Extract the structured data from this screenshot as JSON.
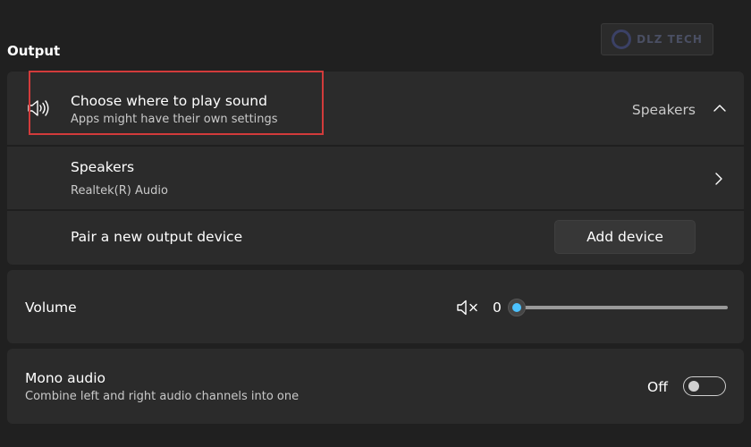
{
  "section": {
    "title": "Output"
  },
  "watermark": {
    "text": "DLZ TECH"
  },
  "output": {
    "choose": {
      "icon": "speaker-icon",
      "title": "Choose where to play sound",
      "subtitle": "Apps might have their own settings",
      "value": "Speakers",
      "expand_icon": "chevron-up-icon"
    },
    "device": {
      "name": "Speakers",
      "driver": "Realtek(R) Audio",
      "nav_icon": "chevron-right-icon"
    },
    "pair": {
      "label": "Pair a new output device",
      "button_label": "Add device"
    }
  },
  "volume": {
    "label": "Volume",
    "icon": "speaker-muted-icon",
    "value": "0",
    "level": 0
  },
  "mono": {
    "title": "Mono audio",
    "subtitle": "Combine left and right audio channels into one",
    "state_label": "Off",
    "enabled": false
  },
  "colors": {
    "background": "#202020",
    "card": "#2b2b2b",
    "accent": "#4cc2ff",
    "highlight": "#d23b3b"
  }
}
